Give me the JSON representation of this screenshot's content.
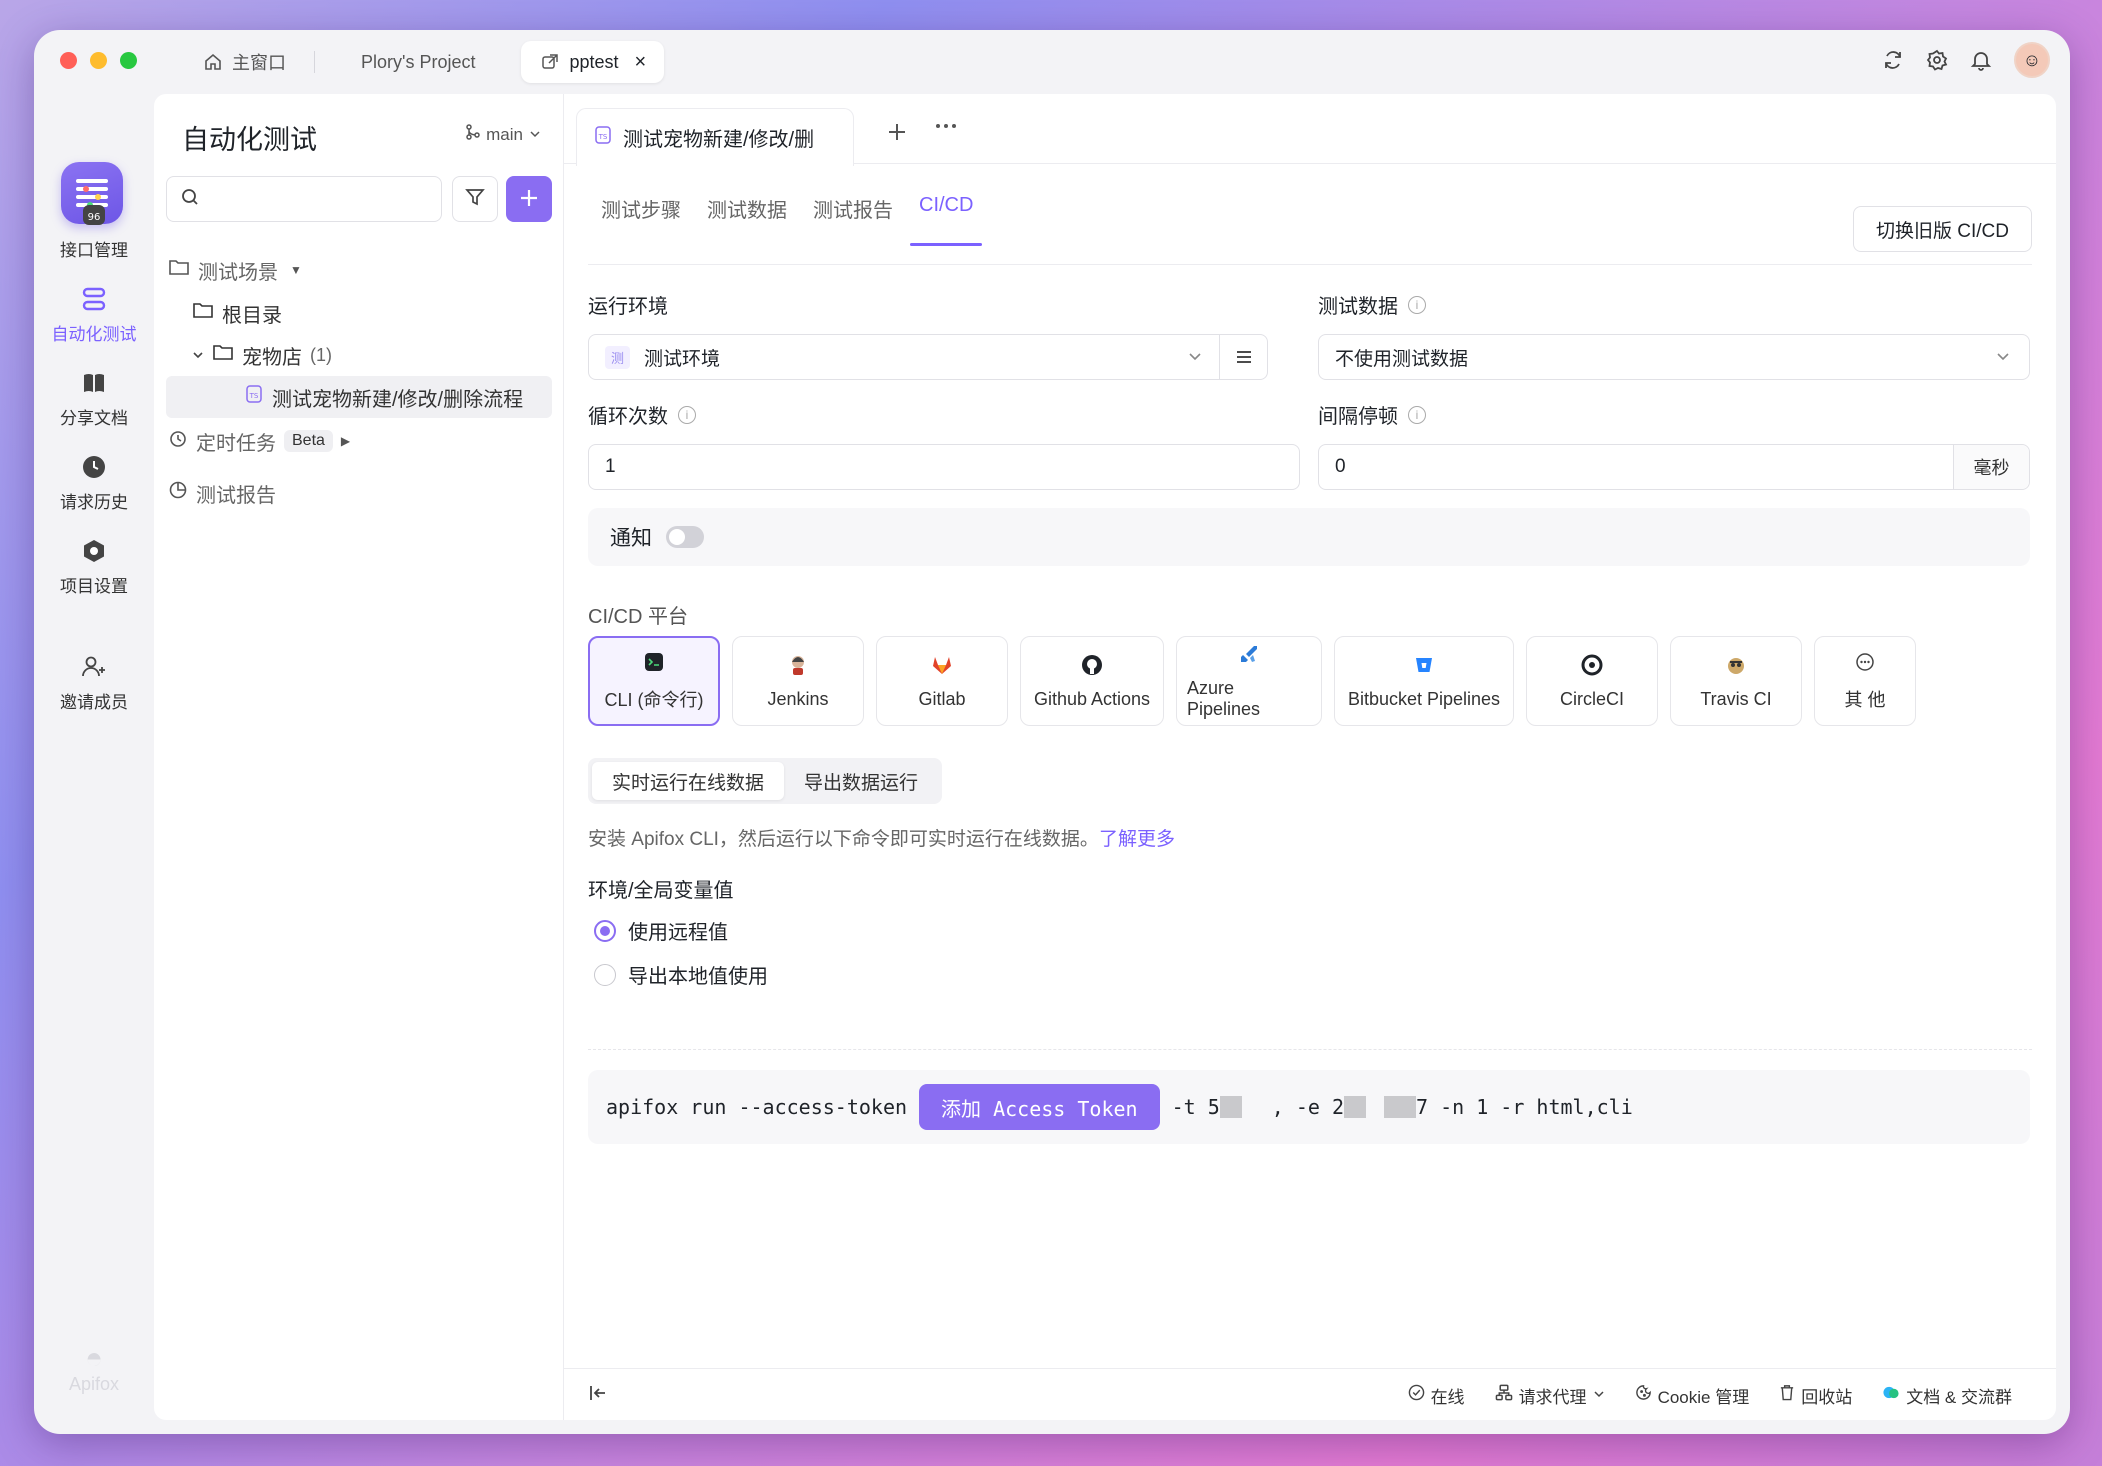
{
  "titlebar": {
    "tabs": [
      {
        "label": "主窗口",
        "icon": "home-icon"
      },
      {
        "label": "Plory's Project"
      },
      {
        "label": "pptest",
        "icon": "external-link-icon",
        "close": "×"
      }
    ]
  },
  "rail": {
    "items": [
      {
        "label": "接口管理",
        "icon": "api-icon"
      },
      {
        "label": "自动化测试",
        "icon": "automation-icon"
      },
      {
        "label": "分享文档",
        "icon": "book-icon"
      },
      {
        "label": "请求历史",
        "icon": "clock-icon"
      },
      {
        "label": "项目设置",
        "icon": "hexagon-settings-icon"
      },
      {
        "label": "邀请成员",
        "icon": "user-plus-icon"
      }
    ],
    "brand": "Apifox"
  },
  "sidebar": {
    "title": "自动化测试",
    "branch": "main",
    "search_placeholder": "",
    "tree": {
      "scenes": "测试场景",
      "root": "根目录",
      "folder": "宠物店",
      "folder_count": "(1)",
      "case": "测试宠物新建/修改/删除流程",
      "scheduled": "定时任务",
      "beta": "Beta",
      "reports": "测试报告"
    }
  },
  "content": {
    "tab_title": "测试宠物新建/修改/删",
    "subtabs": [
      "测试步骤",
      "测试数据",
      "测试报告",
      "CI/CD"
    ],
    "switch_label": "切换旧版 CI/CD",
    "env_label": "运行环境",
    "env_tag": "测",
    "env_value": "测试环境",
    "data_label": "测试数据",
    "data_value": "不使用测试数据",
    "loop_label": "循环次数",
    "loop_value": "1",
    "interval_label": "间隔停顿",
    "interval_value": "0",
    "interval_unit": "毫秒",
    "notify_label": "通知",
    "platform_label": "CI/CD 平台",
    "platforms": [
      "CLI (命令行)",
      "Jenkins",
      "Gitlab",
      "Github Actions",
      "Azure Pipelines",
      "Bitbucket Pipelines",
      "CircleCI",
      "Travis CI",
      "其 他"
    ],
    "modes": [
      "实时运行在线数据",
      "导出数据运行"
    ],
    "hint": "安装 Apifox CLI，然后运行以下命令即可实时运行在线数据。",
    "hint_link": "了解更多",
    "var_label": "环境/全局变量值",
    "radio_remote": "使用远程值",
    "radio_local": "导出本地值使用",
    "cmd_prefix": "apifox run --access-token",
    "cmd_button": "添加 Access Token",
    "cmd_t": "-t 5",
    "cmd_e": ", -e 2",
    "cmd_suffix": "7 -n 1 -r html,cli"
  },
  "footer": {
    "items": [
      "在线",
      "请求代理",
      "Cookie 管理",
      "回收站",
      "文档 & 交流群"
    ]
  },
  "colors": {
    "accent": "#8a6df2",
    "accent_text": "#7b61ff"
  }
}
